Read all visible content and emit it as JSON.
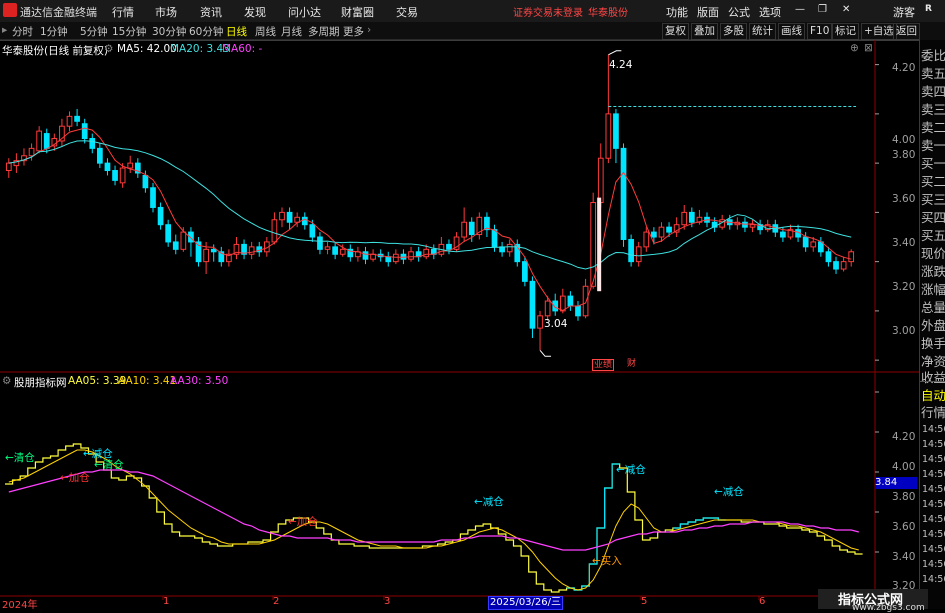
{
  "menubar": {
    "app_title": "通达信金融终端",
    "items": [
      "行情",
      "市场",
      "资讯",
      "发现",
      "问小达",
      "财富圈",
      "交易"
    ],
    "warning": "证券交易未登录",
    "stock": "华泰股份",
    "right_items": [
      "功能",
      "版面",
      "公式",
      "选项"
    ],
    "guest": "游客",
    "logo_letter": "R"
  },
  "toolbar": {
    "periods": [
      "分时",
      "1分钟",
      "5分钟",
      "15分钟",
      "30分钟",
      "60分钟",
      "日线",
      "周线",
      "月线",
      "多周期",
      "更多"
    ],
    "selected": "日线",
    "buttons": [
      "复权",
      "叠加",
      "多股",
      "统计",
      "画线",
      "F10",
      "标记",
      "+自选",
      "返回"
    ]
  },
  "main_chart": {
    "title": "华泰股份(日线 前复权)",
    "ma5": "MA5: 42.00",
    "ma20": "MA20: 3.43",
    "ma60": "MA60: -",
    "y_ticks": [
      "4.20",
      "4.00",
      "3.80",
      "3.60",
      "3.40",
      "3.20",
      "3.00"
    ],
    "high_label": "4.24",
    "low_label": "3.04",
    "events": [
      "业绩",
      "财"
    ],
    "dashed_level": 4.03
  },
  "indicator": {
    "title": "股朋指标网",
    "aa05": "AA05: 3.39",
    "aa10": "AA10: 3.41",
    "aa30": "AA30: 3.50",
    "y_ticks": [
      "4.20",
      "4.00",
      "3.80",
      "3.60",
      "3.40",
      "3.20"
    ],
    "current": "3.84",
    "annotations": [
      {
        "text": "←清仓",
        "color": "#00ff7f"
      },
      {
        "text": "←减仓",
        "color": "#00e5ff"
      },
      {
        "text": "←清仓",
        "color": "#00ff7f"
      },
      {
        "text": "←加仓",
        "color": "#ff3333"
      },
      {
        "text": "←加仓",
        "color": "#ff3333"
      },
      {
        "text": "←减仓",
        "color": "#00e5ff"
      },
      {
        "text": "←减仓",
        "color": "#00e5ff"
      },
      {
        "text": "←减仓",
        "color": "#00e5ff"
      },
      {
        "text": "←买入",
        "color": "#ff9900"
      }
    ]
  },
  "sidebar": {
    "items": [
      "委比",
      "卖五",
      "卖四",
      "卖三",
      "卖二",
      "卖一",
      "买一",
      "买二",
      "买三",
      "买四",
      "买五",
      "现价",
      "涨跌",
      "涨幅",
      "总量",
      "外盘",
      "换手",
      "净资",
      "收益"
    ],
    "section": [
      "自动",
      "行情"
    ],
    "times": [
      "14:56",
      "14:56",
      "14:56",
      "14:56",
      "14:56",
      "14:56",
      "14:56",
      "14:56",
      "14:56",
      "14:56",
      "14:56"
    ]
  },
  "date_axis": {
    "labels": [
      "2024年",
      "1",
      "2",
      "3",
      "4",
      "5",
      "6"
    ],
    "selected": "2025/03/26/三"
  },
  "watermark": {
    "line1": "指标公式网",
    "line2": "www.zbgs3.com"
  },
  "colors": {
    "up": "#ff3b3b",
    "down": "#00e5ff",
    "ma5": "#ffffff",
    "ma20": "#3fe0e0",
    "aa05": "#ffff40",
    "aa10": "#ffd200",
    "aa30": "#ff40ff",
    "axis": "#a0a0a0",
    "grid": "#3a0000"
  },
  "chart_data": {
    "type": "candlestick",
    "price_range": [
      2.96,
      4.3
    ],
    "candles": [
      [
        3.77,
        3.8,
        3.74,
        3.82
      ],
      [
        3.79,
        3.81,
        3.76,
        3.84
      ],
      [
        3.81,
        3.83,
        3.79,
        3.86
      ],
      [
        3.83,
        3.86,
        3.81,
        3.88
      ],
      [
        3.85,
        3.93,
        3.84,
        3.95
      ],
      [
        3.92,
        3.86,
        3.84,
        3.94
      ],
      [
        3.87,
        3.9,
        3.85,
        3.92
      ],
      [
        3.89,
        3.95,
        3.87,
        3.98
      ],
      [
        3.95,
        3.99,
        3.93,
        4.01
      ],
      [
        3.99,
        3.97,
        3.95,
        4.02
      ],
      [
        3.96,
        3.9,
        3.88,
        3.98
      ],
      [
        3.9,
        3.86,
        3.84,
        3.92
      ],
      [
        3.86,
        3.8,
        3.78,
        3.88
      ],
      [
        3.8,
        3.77,
        3.75,
        3.82
      ],
      [
        3.77,
        3.73,
        3.71,
        3.79
      ],
      [
        3.72,
        3.78,
        3.7,
        3.8
      ],
      [
        3.78,
        3.8,
        3.76,
        3.83
      ],
      [
        3.8,
        3.76,
        3.74,
        3.82
      ],
      [
        3.75,
        3.7,
        3.68,
        3.77
      ],
      [
        3.7,
        3.62,
        3.6,
        3.72
      ],
      [
        3.62,
        3.55,
        3.53,
        3.64
      ],
      [
        3.55,
        3.48,
        3.46,
        3.57
      ],
      [
        3.48,
        3.45,
        3.43,
        3.51
      ],
      [
        3.45,
        3.52,
        3.44,
        3.54
      ],
      [
        3.52,
        3.48,
        3.42,
        3.54
      ],
      [
        3.48,
        3.4,
        3.38,
        3.5
      ],
      [
        3.4,
        3.45,
        3.35,
        3.48
      ],
      [
        3.45,
        3.44,
        3.4,
        3.47
      ],
      [
        3.44,
        3.4,
        3.38,
        3.46
      ],
      [
        3.4,
        3.43,
        3.38,
        3.45
      ],
      [
        3.43,
        3.47,
        3.41,
        3.5
      ],
      [
        3.47,
        3.43,
        3.41,
        3.49
      ],
      [
        3.43,
        3.46,
        3.41,
        3.48
      ],
      [
        3.46,
        3.44,
        3.42,
        3.48
      ],
      [
        3.44,
        3.48,
        3.42,
        3.5
      ],
      [
        3.48,
        3.57,
        3.47,
        3.6
      ],
      [
        3.57,
        3.6,
        3.54,
        3.62
      ],
      [
        3.6,
        3.56,
        3.53,
        3.62
      ],
      [
        3.56,
        3.58,
        3.54,
        3.6
      ],
      [
        3.58,
        3.55,
        3.53,
        3.6
      ],
      [
        3.55,
        3.5,
        3.48,
        3.57
      ],
      [
        3.5,
        3.45,
        3.43,
        3.52
      ],
      [
        3.45,
        3.46,
        3.43,
        3.48
      ],
      [
        3.46,
        3.43,
        3.41,
        3.48
      ],
      [
        3.43,
        3.45,
        3.42,
        3.47
      ],
      [
        3.45,
        3.42,
        3.4,
        3.47
      ],
      [
        3.42,
        3.44,
        3.4,
        3.46
      ],
      [
        3.44,
        3.41,
        3.39,
        3.46
      ],
      [
        3.41,
        3.43,
        3.4,
        3.45
      ],
      [
        3.43,
        3.42,
        3.4,
        3.45
      ],
      [
        3.42,
        3.4,
        3.38,
        3.44
      ],
      [
        3.4,
        3.43,
        3.39,
        3.45
      ],
      [
        3.43,
        3.41,
        3.39,
        3.45
      ],
      [
        3.41,
        3.44,
        3.4,
        3.46
      ],
      [
        3.44,
        3.42,
        3.4,
        3.46
      ],
      [
        3.42,
        3.45,
        3.41,
        3.47
      ],
      [
        3.45,
        3.43,
        3.41,
        3.47
      ],
      [
        3.43,
        3.47,
        3.42,
        3.5
      ],
      [
        3.47,
        3.45,
        3.43,
        3.49
      ],
      [
        3.45,
        3.5,
        3.44,
        3.52
      ],
      [
        3.5,
        3.56,
        3.48,
        3.62
      ],
      [
        3.56,
        3.51,
        3.48,
        3.58
      ],
      [
        3.51,
        3.58,
        3.49,
        3.6
      ],
      [
        3.58,
        3.53,
        3.5,
        3.6
      ],
      [
        3.53,
        3.46,
        3.44,
        3.55
      ],
      [
        3.46,
        3.44,
        3.42,
        3.48
      ],
      [
        3.44,
        3.47,
        3.42,
        3.49
      ],
      [
        3.47,
        3.4,
        3.38,
        3.49
      ],
      [
        3.4,
        3.32,
        3.3,
        3.42
      ],
      [
        3.32,
        3.13,
        3.09,
        3.34
      ],
      [
        3.13,
        3.18,
        3.04,
        3.2
      ],
      [
        3.18,
        3.24,
        3.16,
        3.26
      ],
      [
        3.24,
        3.2,
        3.18,
        3.27
      ],
      [
        3.2,
        3.26,
        3.19,
        3.29
      ],
      [
        3.26,
        3.22,
        3.2,
        3.28
      ],
      [
        3.22,
        3.18,
        3.16,
        3.24
      ],
      [
        3.18,
        3.3,
        3.17,
        3.33
      ],
      [
        3.3,
        3.64,
        3.29,
        3.68
      ],
      [
        3.64,
        3.82,
        3.62,
        3.88
      ],
      [
        3.82,
        4.0,
        3.8,
        4.24
      ],
      [
        4.0,
        3.86,
        3.8,
        4.02
      ],
      [
        3.86,
        3.49,
        3.46,
        3.88
      ],
      [
        3.49,
        3.4,
        3.38,
        3.51
      ],
      [
        3.4,
        3.46,
        3.38,
        3.48
      ],
      [
        3.46,
        3.52,
        3.44,
        3.54
      ],
      [
        3.52,
        3.5,
        3.47,
        3.54
      ],
      [
        3.5,
        3.54,
        3.48,
        3.56
      ],
      [
        3.54,
        3.52,
        3.5,
        3.56
      ],
      [
        3.52,
        3.55,
        3.5,
        3.58
      ],
      [
        3.55,
        3.6,
        3.53,
        3.63
      ],
      [
        3.6,
        3.56,
        3.54,
        3.62
      ],
      [
        3.56,
        3.58,
        3.55,
        3.61
      ],
      [
        3.58,
        3.56,
        3.54,
        3.6
      ],
      [
        3.56,
        3.54,
        3.52,
        3.58
      ],
      [
        3.54,
        3.57,
        3.53,
        3.59
      ],
      [
        3.57,
        3.55,
        3.53,
        3.59
      ],
      [
        3.55,
        3.56,
        3.53,
        3.58
      ],
      [
        3.56,
        3.54,
        3.52,
        3.58
      ],
      [
        3.54,
        3.55,
        3.52,
        3.57
      ],
      [
        3.55,
        3.53,
        3.51,
        3.57
      ],
      [
        3.53,
        3.55,
        3.52,
        3.57
      ],
      [
        3.55,
        3.52,
        3.5,
        3.57
      ],
      [
        3.52,
        3.5,
        3.48,
        3.54
      ],
      [
        3.5,
        3.53,
        3.49,
        3.55
      ],
      [
        3.53,
        3.5,
        3.48,
        3.55
      ],
      [
        3.5,
        3.46,
        3.44,
        3.52
      ],
      [
        3.46,
        3.48,
        3.44,
        3.5
      ],
      [
        3.48,
        3.44,
        3.42,
        3.5
      ],
      [
        3.44,
        3.4,
        3.38,
        3.46
      ],
      [
        3.4,
        3.37,
        3.35,
        3.42
      ],
      [
        3.37,
        3.4,
        3.36,
        3.42
      ],
      [
        3.4,
        3.44,
        3.38,
        3.45
      ]
    ],
    "indicator_range": [
      3.18,
      4.3
    ],
    "aa05": [
      3.74,
      3.76,
      3.78,
      3.82,
      3.85,
      3.87,
      3.88,
      3.91,
      3.93,
      3.94,
      3.92,
      3.89,
      3.85,
      3.81,
      3.77,
      3.76,
      3.78,
      3.77,
      3.73,
      3.67,
      3.6,
      3.54,
      3.5,
      3.48,
      3.48,
      3.47,
      3.45,
      3.44,
      3.43,
      3.43,
      3.44,
      3.44,
      3.45,
      3.45,
      3.46,
      3.5,
      3.54,
      3.56,
      3.57,
      3.57,
      3.55,
      3.52,
      3.49,
      3.46,
      3.44,
      3.44,
      3.43,
      3.43,
      3.42,
      3.42,
      3.42,
      3.42,
      3.42,
      3.42,
      3.42,
      3.43,
      3.43,
      3.44,
      3.45,
      3.46,
      3.49,
      3.51,
      3.53,
      3.54,
      3.52,
      3.49,
      3.46,
      3.43,
      3.38,
      3.3,
      3.24,
      3.21,
      3.2,
      3.21,
      3.22,
      3.21,
      3.23,
      3.34,
      3.52,
      3.72,
      3.84,
      3.82,
      3.7,
      3.56,
      3.46,
      3.47,
      3.5,
      3.51,
      3.52,
      3.54,
      3.55,
      3.56,
      3.57,
      3.57,
      3.56,
      3.56,
      3.56,
      3.55,
      3.55,
      3.55,
      3.54,
      3.54,
      3.53,
      3.52,
      3.52,
      3.51,
      3.5,
      3.48,
      3.46,
      3.43,
      3.41,
      3.4,
      3.39
    ],
    "aa10": [
      3.75,
      3.76,
      3.77,
      3.79,
      3.81,
      3.83,
      3.85,
      3.87,
      3.89,
      3.91,
      3.91,
      3.9,
      3.88,
      3.86,
      3.83,
      3.81,
      3.79,
      3.76,
      3.73,
      3.69,
      3.65,
      3.61,
      3.58,
      3.55,
      3.52,
      3.5,
      3.48,
      3.47,
      3.45,
      3.44,
      3.44,
      3.44,
      3.44,
      3.44,
      3.45,
      3.46,
      3.48,
      3.5,
      3.52,
      3.54,
      3.55,
      3.55,
      3.54,
      3.52,
      3.5,
      3.48,
      3.46,
      3.45,
      3.44,
      3.43,
      3.43,
      3.43,
      3.42,
      3.42,
      3.42,
      3.42,
      3.43,
      3.43,
      3.44,
      3.45,
      3.46,
      3.48,
      3.5,
      3.51,
      3.52,
      3.51,
      3.49,
      3.47,
      3.44,
      3.4,
      3.35,
      3.31,
      3.27,
      3.24,
      3.22,
      3.21,
      3.22,
      3.26,
      3.33,
      3.43,
      3.53,
      3.6,
      3.64,
      3.62,
      3.57,
      3.52,
      3.5,
      3.5,
      3.51,
      3.52,
      3.53,
      3.54,
      3.55,
      3.56,
      3.56,
      3.56,
      3.56,
      3.56,
      3.56,
      3.55,
      3.55,
      3.55,
      3.54,
      3.53,
      3.53,
      3.52,
      3.51,
      3.5,
      3.48,
      3.46,
      3.44,
      3.42,
      3.41
    ],
    "aa30": [
      3.7,
      3.71,
      3.72,
      3.73,
      3.74,
      3.75,
      3.76,
      3.77,
      3.78,
      3.79,
      3.8,
      3.8,
      3.81,
      3.81,
      3.81,
      3.81,
      3.8,
      3.8,
      3.79,
      3.78,
      3.76,
      3.74,
      3.72,
      3.7,
      3.68,
      3.66,
      3.64,
      3.62,
      3.6,
      3.58,
      3.56,
      3.54,
      3.53,
      3.51,
      3.5,
      3.49,
      3.48,
      3.48,
      3.47,
      3.47,
      3.47,
      3.47,
      3.47,
      3.46,
      3.46,
      3.46,
      3.45,
      3.45,
      3.45,
      3.45,
      3.45,
      3.45,
      3.45,
      3.45,
      3.45,
      3.45,
      3.45,
      3.46,
      3.46,
      3.46,
      3.47,
      3.47,
      3.48,
      3.48,
      3.48,
      3.48,
      3.47,
      3.47,
      3.46,
      3.45,
      3.44,
      3.43,
      3.42,
      3.41,
      3.41,
      3.41,
      3.41,
      3.42,
      3.43,
      3.44,
      3.46,
      3.47,
      3.48,
      3.49,
      3.49,
      3.5,
      3.5,
      3.5,
      3.5,
      3.51,
      3.51,
      3.52,
      3.52,
      3.53,
      3.53,
      3.54,
      3.54,
      3.54,
      3.55,
      3.55,
      3.55,
      3.55,
      3.55,
      3.54,
      3.54,
      3.53,
      3.53,
      3.52,
      3.52,
      3.51,
      3.51,
      3.51,
      3.5
    ]
  }
}
